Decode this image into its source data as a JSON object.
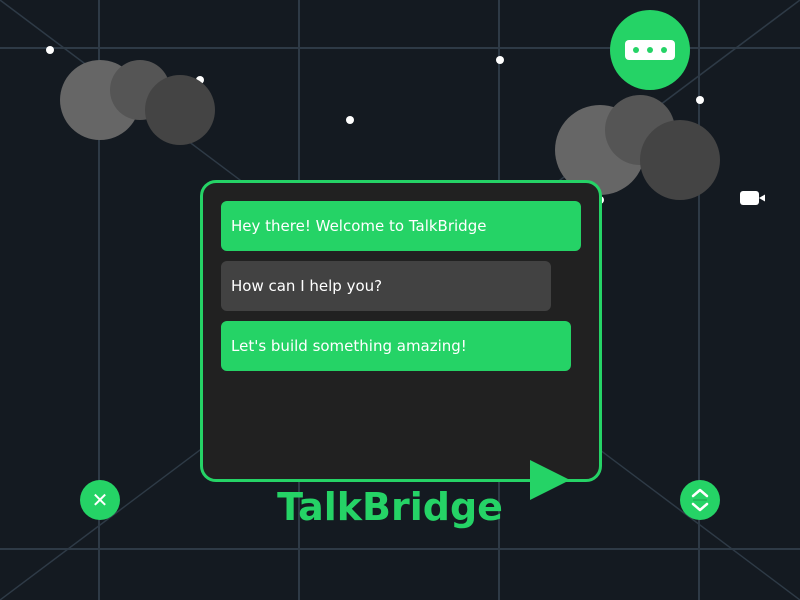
{
  "app": {
    "name": "TalkBridge"
  },
  "messages": [
    {
      "text": "Hey there! Welcome to TalkBridge",
      "style": "sent"
    },
    {
      "text": "How can I help you?",
      "style": "received"
    },
    {
      "text": "Let's build something amazing!",
      "style": "sent"
    }
  ],
  "icons": {
    "typing": "typing-indicator-icon",
    "video": "video-camera-icon",
    "send": "send-arrow-icon",
    "close": "close-icon",
    "close_glyph": "✕",
    "scroll": "scroll-updown-icon"
  },
  "colors": {
    "background": "#141a21",
    "accent": "#25d366",
    "panel": "#212121",
    "received_bubble": "#424242",
    "grid": "#2e3a46",
    "cloud_light": "#666666",
    "cloud_mid": "#555555",
    "cloud_dark": "#444444"
  }
}
